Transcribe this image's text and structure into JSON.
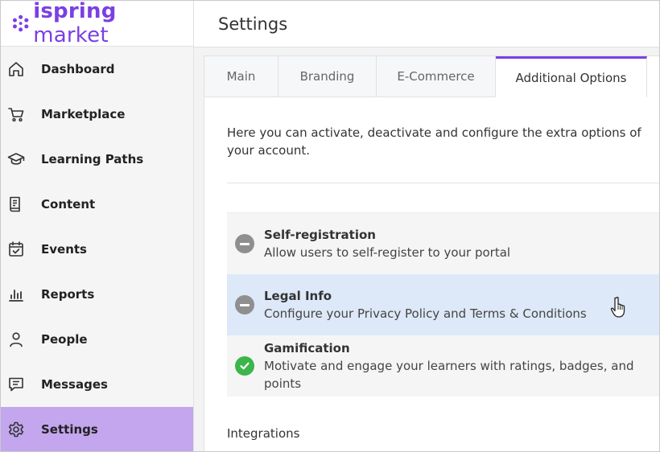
{
  "app": {
    "logo_bold": "ispring",
    "logo_light": " market"
  },
  "sidebar": {
    "items": [
      {
        "label": "Dashboard",
        "icon": "home-icon"
      },
      {
        "label": "Marketplace",
        "icon": "cart-icon"
      },
      {
        "label": "Learning Paths",
        "icon": "graduation-cap-icon"
      },
      {
        "label": "Content",
        "icon": "document-icon"
      },
      {
        "label": "Events",
        "icon": "calendar-check-icon"
      },
      {
        "label": "Reports",
        "icon": "bar-chart-icon"
      },
      {
        "label": "People",
        "icon": "person-icon"
      },
      {
        "label": "Messages",
        "icon": "message-icon"
      },
      {
        "label": "Settings",
        "icon": "gear-icon",
        "active": true
      }
    ],
    "active_color": "#c3a6ee"
  },
  "header": {
    "title": "Settings"
  },
  "tabs": [
    {
      "label": "Main"
    },
    {
      "label": "Branding"
    },
    {
      "label": "E-Commerce"
    },
    {
      "label": "Additional Options",
      "active": true
    }
  ],
  "content": {
    "intro": "Here you can activate, deactivate and configure the extra options of your account.",
    "options": [
      {
        "title": "Self-registration",
        "description": "Allow users to self-register to your portal",
        "status": "inactive"
      },
      {
        "title": "Legal Info",
        "description": "Configure your Privacy Policy and Terms & Conditions",
        "status": "inactive"
      },
      {
        "title": "Gamification",
        "description": "Motivate and engage your learners with ratings, badges, and points",
        "status": "active"
      }
    ],
    "section_integrations": "Integrations"
  },
  "colors": {
    "brand": "#7b3fe4",
    "active_status": "#3cb54a",
    "inactive_status": "#8f8f8f",
    "hover_row": "#dde9f8"
  }
}
